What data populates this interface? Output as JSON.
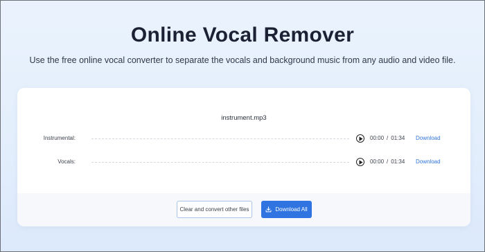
{
  "page": {
    "title": "Online Vocal Remover",
    "subtitle": "Use the free online vocal converter to separate the vocals and background music from any audio and video file."
  },
  "player": {
    "filename": "instrument.mp3",
    "tracks": [
      {
        "label": "Instrumental:",
        "current_time": "00:00",
        "separator": "/",
        "duration": "01:34",
        "download_label": "Download",
        "icon": "play-icon"
      },
      {
        "label": "Vocals:",
        "current_time": "00:00",
        "separator": "/",
        "duration": "01:34",
        "download_label": "Download",
        "icon": "play-icon"
      }
    ]
  },
  "actions": {
    "clear_label": "Clear and convert other files",
    "download_all_label": "Download All",
    "download_all_icon": "download-icon"
  },
  "colors": {
    "accent": "#2f74e0",
    "link": "#2f74d8",
    "background": "#e3eefc"
  }
}
